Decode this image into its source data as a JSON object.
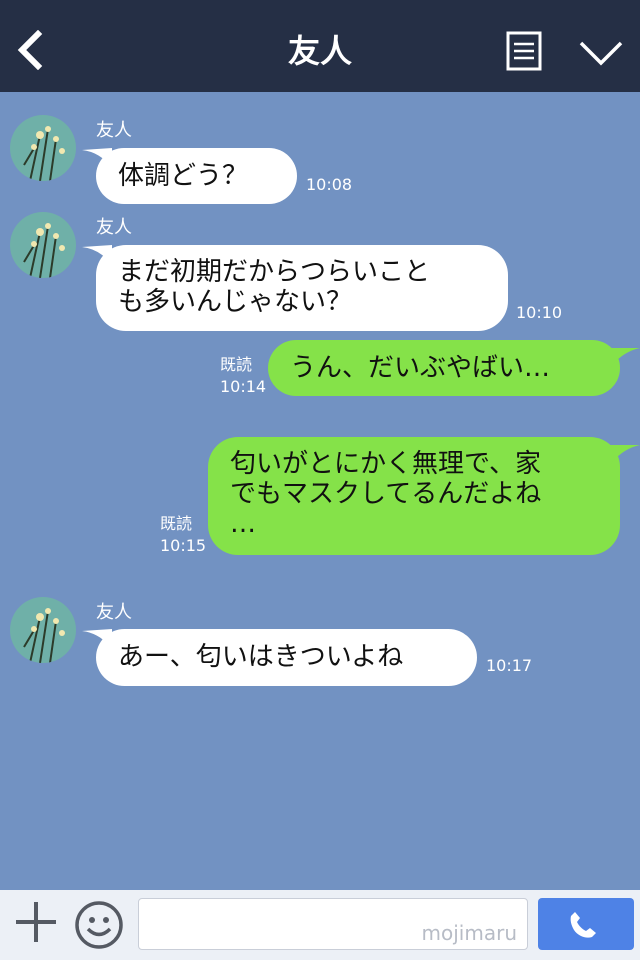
{
  "header": {
    "title": "友人",
    "back_icon": "chevron-left-icon",
    "memo_icon": "notes-icon",
    "menu_icon": "chevron-down-icon"
  },
  "messages": [
    {
      "sender": "友人",
      "text": "体調どう？",
      "time": "10:08"
    },
    {
      "sender": "友人",
      "text_lines": [
        "まだ初期だからつらいこと",
        "も多いんじゃない？"
      ],
      "time": "10:10"
    },
    {
      "read": "既読",
      "text": "うん、だいぶやばい…",
      "time": "10:14"
    },
    {
      "read": "既読",
      "text_lines": [
        "匂いがとにかく無理で、家",
        "でもマスクしてるんだよね",
        "…"
      ],
      "time": "10:15"
    },
    {
      "sender": "友人",
      "text": "あー、匂いはきついよね",
      "time": "10:17"
    }
  ],
  "footer": {
    "plus_icon": "plus-icon",
    "emoji_icon": "smiley-icon",
    "watermark": "mojimaru",
    "call_icon": "phone-icon"
  }
}
